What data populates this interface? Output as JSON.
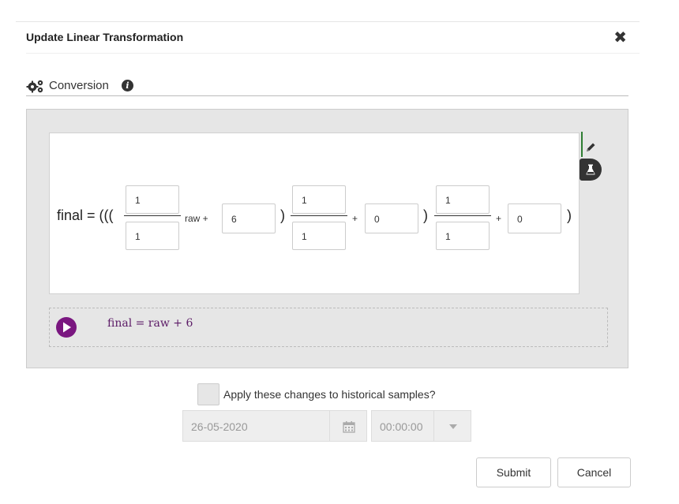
{
  "dialog": {
    "title": "Update Linear Transformation",
    "close_glyph": "✖"
  },
  "section": {
    "label": "Conversion",
    "icons": [
      "gears-icon",
      "info-icon"
    ]
  },
  "equation": {
    "lhs": "final = (((",
    "stage1": {
      "numerator": "1",
      "denominator": "1",
      "var_label": "raw +",
      "offset": "6"
    },
    "stage2": {
      "close_paren": ")",
      "numerator": "1",
      "denominator": "1",
      "plus": "+",
      "offset": "0"
    },
    "stage3": {
      "close_paren": ")",
      "numerator": "1",
      "denominator": "1",
      "plus": "+",
      "offset": "0",
      "final_paren": ")"
    },
    "tools": [
      "pencil-icon",
      "flask-icon"
    ]
  },
  "result": {
    "formula": "final = raw + 6",
    "play_icon": "play-icon"
  },
  "historical": {
    "checkbox_checked": false,
    "label": "Apply these changes to historical samples?",
    "date_value": "26-05-2020",
    "time_value": "00:00:00"
  },
  "buttons": {
    "submit": "Submit",
    "cancel": "Cancel"
  },
  "colors": {
    "accent_purple": "#7a1780",
    "formula_purple": "#5b1a66",
    "green_bar": "#2e7d32",
    "panel_gray": "#e6e6e6"
  }
}
